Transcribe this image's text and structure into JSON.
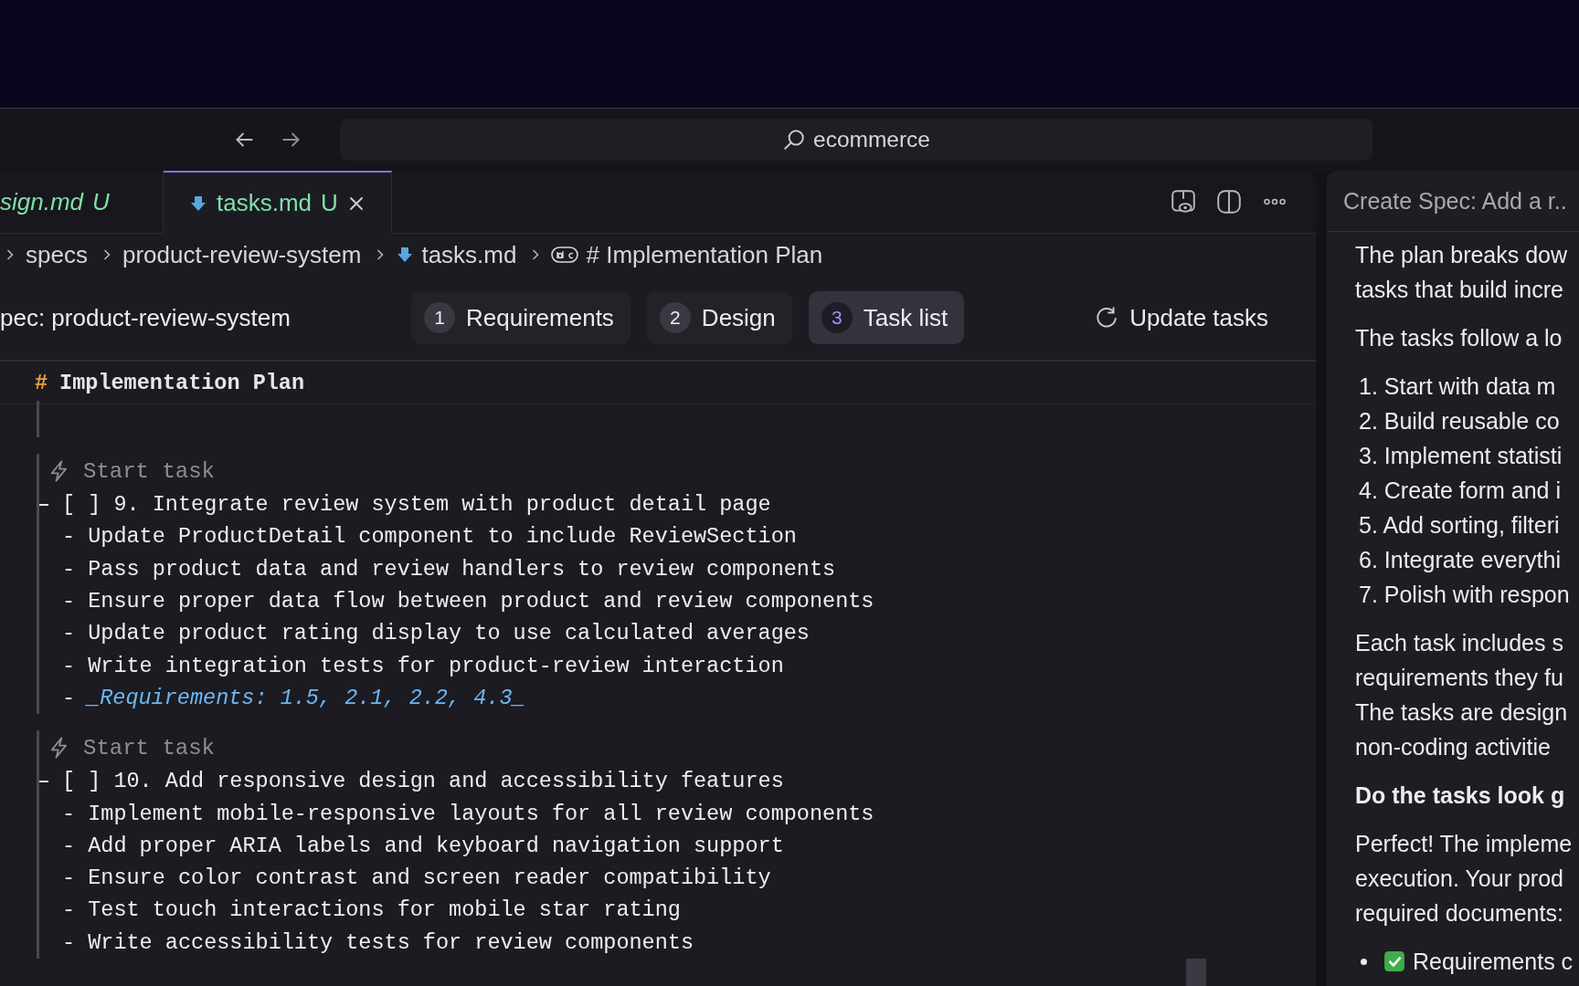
{
  "title_bar": {
    "search": "ecommerce"
  },
  "tabs": [
    {
      "label": "sign.md",
      "status": "U",
      "preview": true,
      "selected": false,
      "closable": false
    },
    {
      "label": "tasks.md",
      "status": "U",
      "preview": false,
      "selected": true,
      "closable": true
    }
  ],
  "breadcrumb": [
    {
      "label": "specs",
      "kind": "folder"
    },
    {
      "label": "product-review-system",
      "kind": "folder"
    },
    {
      "label": "tasks.md",
      "kind": "file"
    },
    {
      "label": "# Implementation Plan",
      "kind": "heading"
    }
  ],
  "spec_header": {
    "title": "pec: product-review-system",
    "steps": [
      {
        "number": "1",
        "label": "Requirements",
        "selected": false
      },
      {
        "number": "2",
        "label": "Design",
        "selected": false
      },
      {
        "number": "3",
        "label": "Task list",
        "selected": true
      }
    ],
    "action": "Update tasks"
  },
  "editor": {
    "heading_mark": "#",
    "heading": "Implementation Plan",
    "tasks": [
      {
        "action": "Start task",
        "checkbox": "[ ]",
        "title": "9. Integrate review system with product detail page",
        "items": [
          "- Update ProductDetail component to include ReviewSection",
          "- Pass product data and review handlers to review components",
          "- Ensure proper data flow between product and review components",
          "- Update product rating display to use calculated averages",
          "- Write integration tests for product-review interaction"
        ],
        "requirements": {
          "bullet": "-",
          "text": "_Requirements: 1.5, 2.1, 2.2, 4.3_"
        }
      },
      {
        "action": "Start task",
        "checkbox": "[ ]",
        "title": "10. Add responsive design and accessibility features",
        "items": [
          "- Implement mobile-responsive layouts for all review components",
          "- Add proper ARIA labels and keyboard navigation support",
          "- Ensure color contrast and screen reader compatibility",
          "- Test touch interactions for mobile star rating",
          "- Write accessibility tests for review components"
        ]
      }
    ]
  },
  "chat": {
    "title": "Create Spec: Add a r..",
    "blocks": [
      {
        "kind": "paragraph",
        "lines": [
          "The plan breaks dow",
          "tasks that build incre"
        ]
      },
      {
        "kind": "paragraph",
        "lines": [
          "The tasks follow a lo"
        ]
      },
      {
        "kind": "numbered",
        "items": [
          {
            "number": "1.",
            "text": "Start with data m"
          },
          {
            "number": "2.",
            "text": "Build reusable co"
          },
          {
            "number": "3.",
            "text": "Implement statisti"
          },
          {
            "number": "4.",
            "text": "Create form and i"
          },
          {
            "number": "5.",
            "text": "Add sorting, filteri"
          },
          {
            "number": "6.",
            "text": "Integrate everythi"
          },
          {
            "number": "7.",
            "text": "Polish with respon"
          }
        ]
      },
      {
        "kind": "paragraph",
        "lines": [
          "Each task includes s",
          "requirements they fu",
          "The tasks are design",
          "non-coding activitie"
        ]
      },
      {
        "kind": "bold",
        "lines": [
          "Do the tasks look g"
        ]
      },
      {
        "kind": "paragraph",
        "lines": [
          "Perfect! The impleme",
          "execution. Your prod",
          "required documents:"
        ]
      },
      {
        "kind": "bullets",
        "items": [
          {
            "text": "Requirements c",
            "done": true
          }
        ]
      }
    ]
  }
}
